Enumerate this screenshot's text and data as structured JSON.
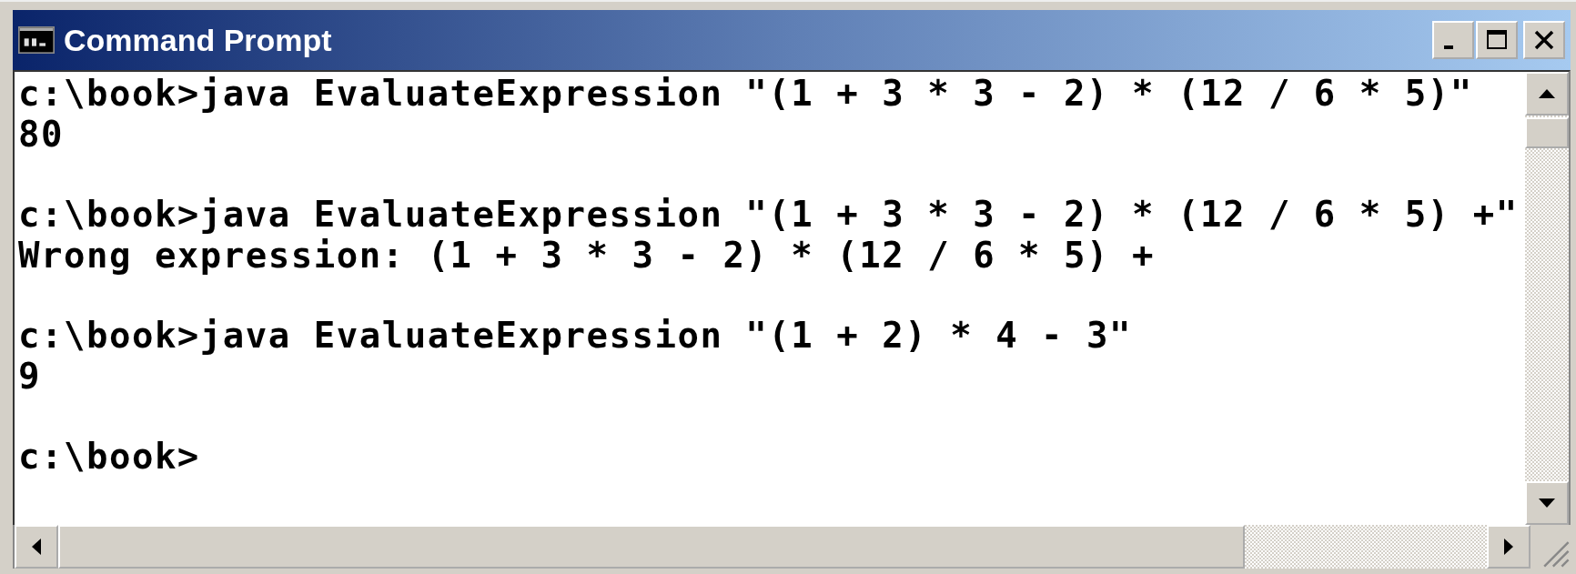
{
  "window": {
    "title": "Command Prompt"
  },
  "console": {
    "blocks": [
      [
        "c:\\book>java EvaluateExpression \"(1 + 3 * 3 - 2) * (12 / 6 * 5)\"",
        "80"
      ],
      [
        "c:\\book>java EvaluateExpression \"(1 + 3 * 3 - 2) * (12 / 6 * 5) +\"",
        "Wrong expression: (1 + 3 * 3 - 2) * (12 / 6 * 5) +"
      ],
      [
        "c:\\book>java EvaluateExpression \"(1 + 2) * 4 - 3\"",
        "9"
      ],
      [
        "c:\\book>"
      ]
    ]
  }
}
